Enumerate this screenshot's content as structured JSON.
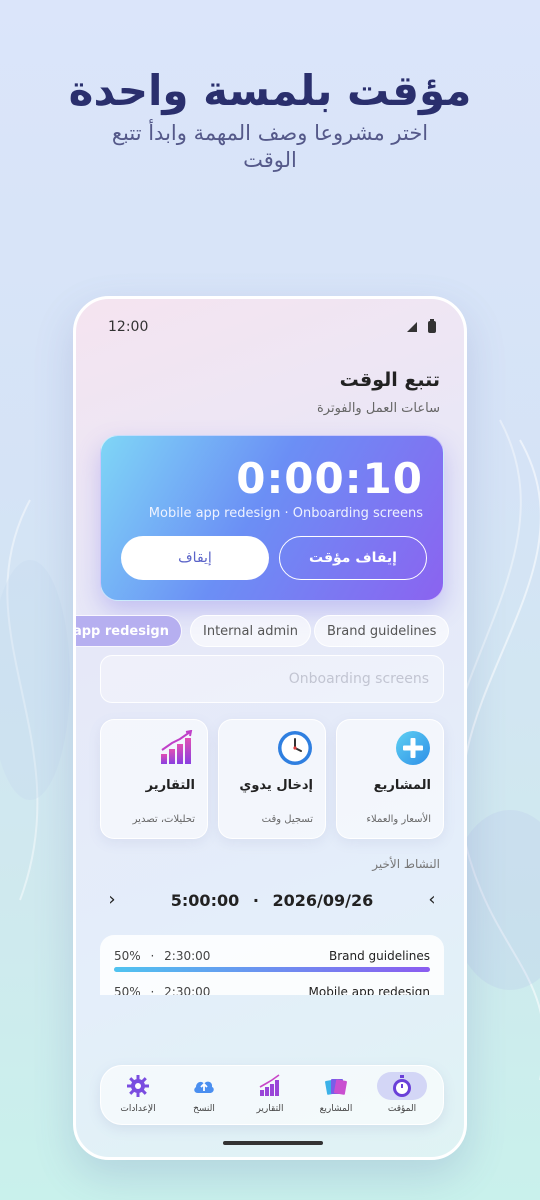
{
  "hero": {
    "title": "مؤقت بلمسة واحدة",
    "subtitle": "اختر مشروعا وصف المهمة وابدأ تتبع الوقت"
  },
  "status_bar": {
    "time": "12:00"
  },
  "screen": {
    "title": "تتبع الوقت",
    "subtitle": "ساعات العمل والفوترة"
  },
  "timer": {
    "value": "0:00:10",
    "task": "Mobile app redesign · Onboarding screens",
    "pause_label": "إيقاف",
    "stop_label": "إيقاف مؤقت",
    "accent_colors": [
      "#7fd6f6",
      "#6b8ff5",
      "#8b63f0"
    ]
  },
  "projects": {
    "chips": [
      {
        "label": "Brand guidelines",
        "active": false
      },
      {
        "label": "Internal admin",
        "active": false
      },
      {
        "label": "Mobile app redesign",
        "active": true
      }
    ]
  },
  "task_input": {
    "placeholder": "Onboarding screens"
  },
  "features": [
    {
      "title": "المشاريع",
      "subtitle": "الأسعار والعملاء",
      "icon": "plus-circle-icon"
    },
    {
      "title": "إدخال يدوي",
      "subtitle": "تسجيل وقت",
      "icon": "clock-icon"
    },
    {
      "title": "التقارير",
      "subtitle": "تحليلات، تصدير",
      "icon": "bar-chart-icon"
    }
  ],
  "recent": {
    "label": "النشاط الأخير",
    "date": "2026/09/26",
    "total": "5:00:00",
    "separator": "·",
    "rows": [
      {
        "name": "Brand guidelines",
        "duration": "2:30:00",
        "percent": "50%",
        "fraction": 1.0
      },
      {
        "name": "Mobile app redesign",
        "duration": "2:30:00",
        "percent": "50%",
        "fraction": 1.0
      }
    ]
  },
  "tabbar": {
    "items": [
      {
        "label": "المؤقت",
        "icon": "stopwatch-icon",
        "active": true
      },
      {
        "label": "المشاريع",
        "icon": "folders-icon",
        "active": false
      },
      {
        "label": "التقارير",
        "icon": "bar-chart-icon",
        "active": false
      },
      {
        "label": "النسخ",
        "icon": "cloud-upload-icon",
        "active": false
      },
      {
        "label": "الإعدادات",
        "icon": "gear-icon",
        "active": false
      }
    ]
  }
}
